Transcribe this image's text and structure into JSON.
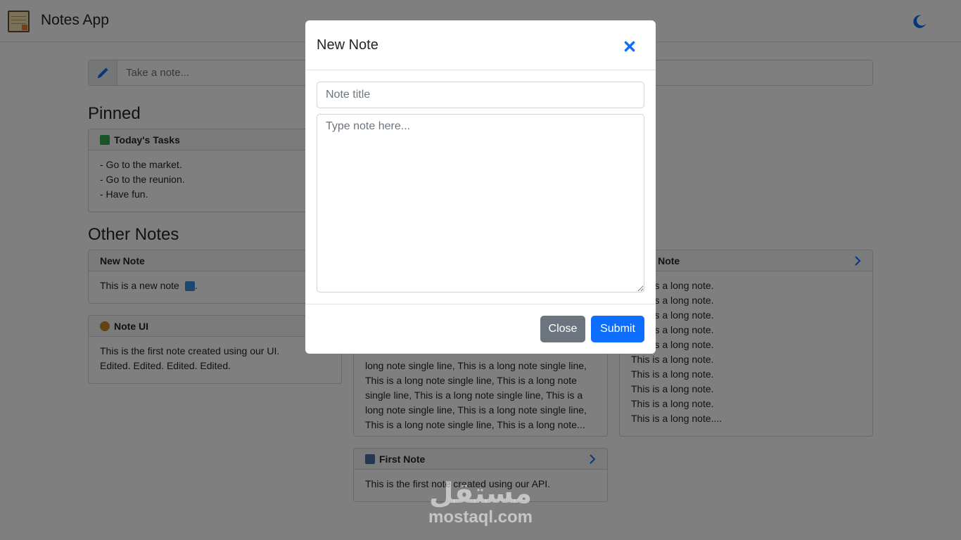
{
  "app": {
    "title": "Notes App"
  },
  "search": {
    "placeholder": "Take a note..."
  },
  "sections": {
    "pinned": "Pinned",
    "other": "Other Notes"
  },
  "notes": {
    "todays_tasks": {
      "title": "Today's Tasks",
      "lines": [
        "- Go to the market.",
        "- Go to the reunion.",
        "- Have fun."
      ]
    },
    "new_note": {
      "title": "New Note",
      "body": "This is a new note",
      "suffix": "."
    },
    "note_ui": {
      "title": "Note UI",
      "body": "This is the first note created using our UI. Edited. Edited. Edited. Edited."
    },
    "long_single": {
      "lines": [
        "long note single line, This is a long note single line,",
        "This is a long note single line, This is a long note",
        "single line, This is a long note single line, This is a",
        "long note single line, This is a long note single line,",
        "This is a long note single line, This is a long note..."
      ]
    },
    "long_note": {
      "title": "Long Note",
      "lines": [
        "This is a long note.",
        "This is a long note.",
        "This is a long note.",
        "This is a long note.",
        "This is a long note.",
        "This is a long note.",
        "This is a long note.",
        "This is a long note.",
        "This is a long note.",
        "This is a long note...."
      ]
    },
    "first_note": {
      "title": "First Note",
      "body": "This is the first note created using our API."
    }
  },
  "modal": {
    "title": "New Note",
    "title_placeholder": "Note title",
    "body_placeholder": "Type note here...",
    "close_label": "Close",
    "submit_label": "Submit"
  },
  "watermark": {
    "arabic": "مستقل",
    "latin": "mostaql.com"
  },
  "colors": {
    "primary": "#0d6efd",
    "secondary": "#6c757d",
    "overlay": "rgba(0,0,0,0.5)"
  },
  "icons": [
    "notes-logo-icon",
    "moon-icon",
    "pencil-icon",
    "check-square-icon",
    "new-badge-icon",
    "pine-cone-icon",
    "computer-icon",
    "chevron-right-icon",
    "close-icon"
  ]
}
